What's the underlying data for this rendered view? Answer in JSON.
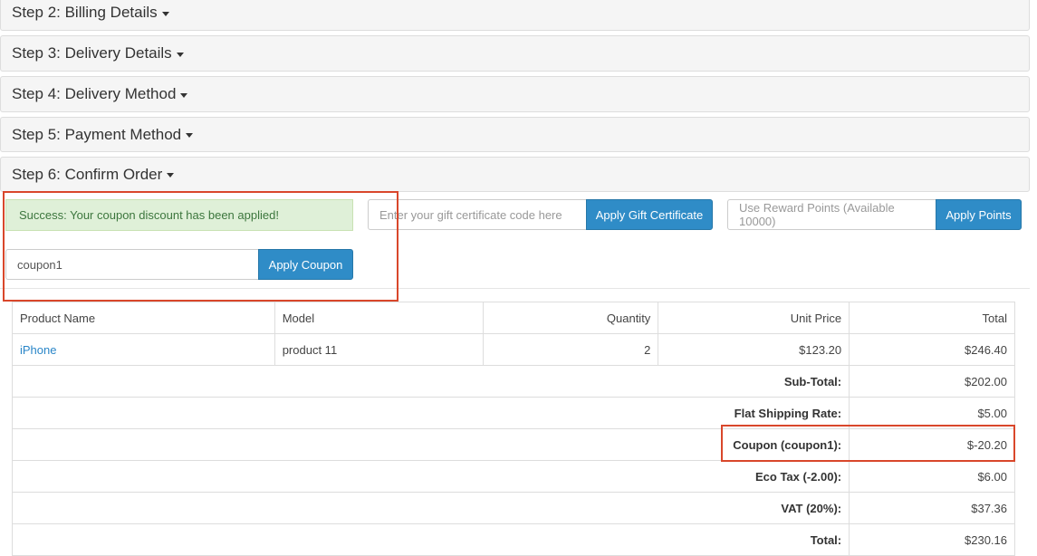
{
  "steps": [
    {
      "label": "Step 2: Billing Details"
    },
    {
      "label": "Step 3: Delivery Details"
    },
    {
      "label": "Step 4: Delivery Method"
    },
    {
      "label": "Step 5: Payment Method"
    },
    {
      "label": "Step 6: Confirm Order"
    }
  ],
  "alert": {
    "success_text": "Success: Your coupon discount has been applied!"
  },
  "gift": {
    "placeholder": "Enter your gift certificate code here",
    "button_label": "Apply Gift Certificate"
  },
  "reward": {
    "placeholder": "Use Reward Points (Available 10000)",
    "button_label": "Apply Points"
  },
  "coupon": {
    "value": "coupon1",
    "button_label": "Apply Coupon"
  },
  "table": {
    "headers": [
      "Product Name",
      "Model",
      "Quantity",
      "Unit Price",
      "Total"
    ],
    "rows": [
      {
        "product": "iPhone",
        "model": "product 11",
        "quantity": "2",
        "unit_price": "$123.20",
        "total": "$246.40"
      }
    ],
    "totals": [
      {
        "label": "Sub-Total:",
        "value": "$202.00"
      },
      {
        "label": "Flat Shipping Rate:",
        "value": "$5.00"
      },
      {
        "label": "Coupon (coupon1):",
        "value": "$-20.20"
      },
      {
        "label": "Eco Tax (-2.00):",
        "value": "$6.00"
      },
      {
        "label": "VAT (20%):",
        "value": "$37.36"
      },
      {
        "label": "Total:",
        "value": "$230.16"
      }
    ]
  },
  "colors": {
    "accent": "#2f8cc7",
    "success_bg": "#dff0d8",
    "highlight": "#d9472b"
  }
}
